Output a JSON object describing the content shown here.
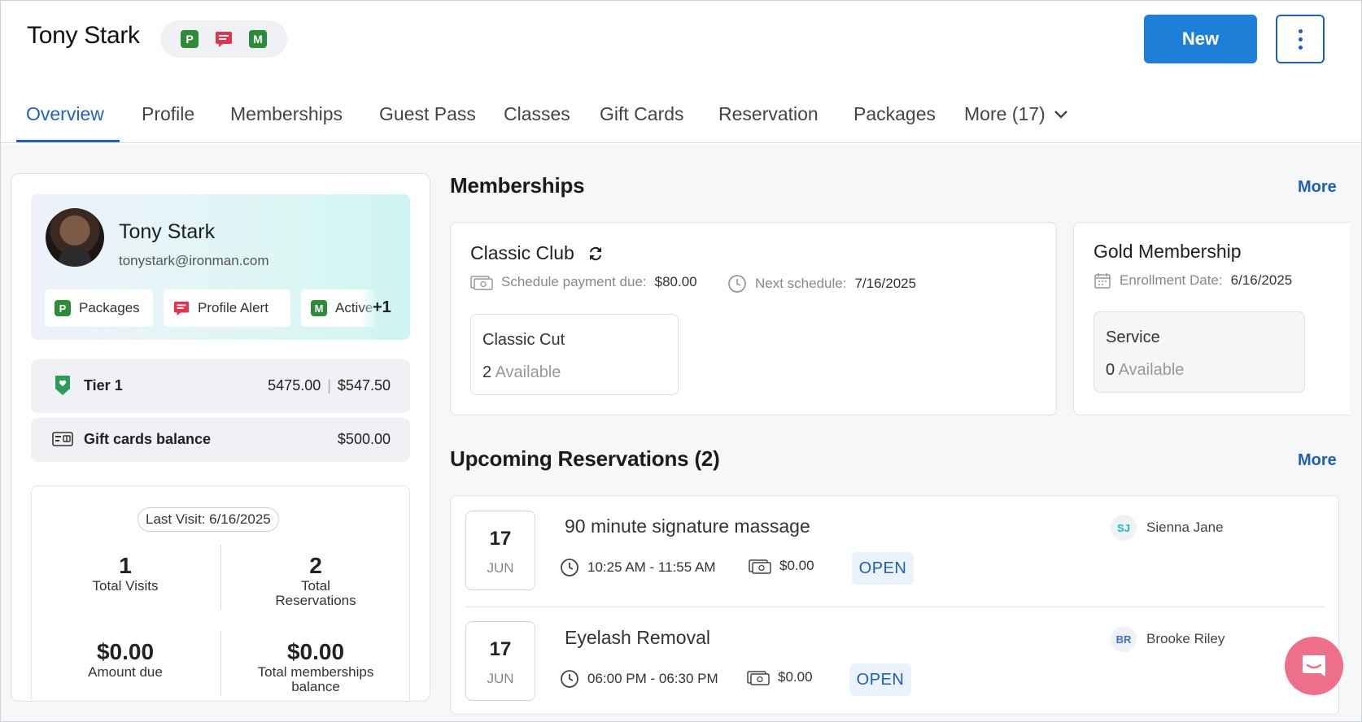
{
  "header": {
    "customer_name": "Tony Stark",
    "badge_icons": [
      "package-p-icon",
      "alert-message-icon",
      "membership-m-icon"
    ],
    "new_button": "New",
    "menu_icon": "kebab-vertical-icon"
  },
  "tabs": [
    {
      "label": "Overview",
      "active": true
    },
    {
      "label": "Profile"
    },
    {
      "label": "Memberships"
    },
    {
      "label": "Guest Pass"
    },
    {
      "label": "Classes"
    },
    {
      "label": "Gift Cards"
    },
    {
      "label": "Reservation"
    },
    {
      "label": "Packages"
    },
    {
      "label": "More (17)"
    }
  ],
  "profile": {
    "name": "Tony Stark",
    "email": "tonystark@ironman.com",
    "chips": [
      {
        "label": "Packages",
        "icon": "package-p-icon"
      },
      {
        "label": "Profile Alert",
        "icon": "alert-message-icon"
      },
      {
        "label": "Active",
        "icon": "membership-m-icon"
      }
    ],
    "extra_chips": "+1"
  },
  "tier": {
    "label": "Tier 1",
    "points": "5475.00",
    "value": "$547.50"
  },
  "gift_cards": {
    "label": "Gift cards balance",
    "value": "$500.00"
  },
  "stats": {
    "last_visit": "Last Visit: 6/16/2025",
    "total_visits": {
      "value": "1",
      "label": "Total Visits"
    },
    "total_reservations": {
      "value": "2",
      "label_line1": "Total",
      "label_line2": "Reservations"
    },
    "amount_due": {
      "value": "$0.00",
      "label": "Amount due"
    },
    "memberships_balance": {
      "value": "$0.00",
      "label_line1": "Total memberships",
      "label_line2": "balance"
    }
  },
  "memberships": {
    "title": "Memberships",
    "more": "More",
    "items": [
      {
        "name": "Classic Club",
        "meta1_label": "Schedule payment due:",
        "meta1_value": "$80.00",
        "meta2_label": "Next schedule:",
        "meta2_value": "7/16/2025",
        "service_name": "Classic Cut",
        "service_count": "2",
        "service_avail": "Available"
      },
      {
        "name": "Gold Membership",
        "meta1_label": "Enrollment Date:",
        "meta1_value": "6/16/2025",
        "service_name": "Service",
        "service_count": "0",
        "service_avail": "Available"
      }
    ]
  },
  "reservations": {
    "title": "Upcoming Reservations (2)",
    "more": "More",
    "items": [
      {
        "day": "17",
        "month": "JUN",
        "title": "90 minute signature massage",
        "time": "10:25 AM - 11:55 AM",
        "price": "$0.00",
        "status": "OPEN",
        "staff_initials": "SJ",
        "staff_name": "Sienna Jane",
        "initials_color": "#19b4c8"
      },
      {
        "day": "17",
        "month": "JUN",
        "title": "Eyelash Removal",
        "time": "06:00 PM - 06:30 PM",
        "price": "$0.00",
        "status": "OPEN",
        "staff_initials": "BR",
        "staff_name": "Brooke Riley",
        "initials_color": "#3d73c9"
      }
    ]
  },
  "colors": {
    "accent": "#1e7fd8",
    "link": "#1e5fb3",
    "chat": "#ee6f8c"
  }
}
